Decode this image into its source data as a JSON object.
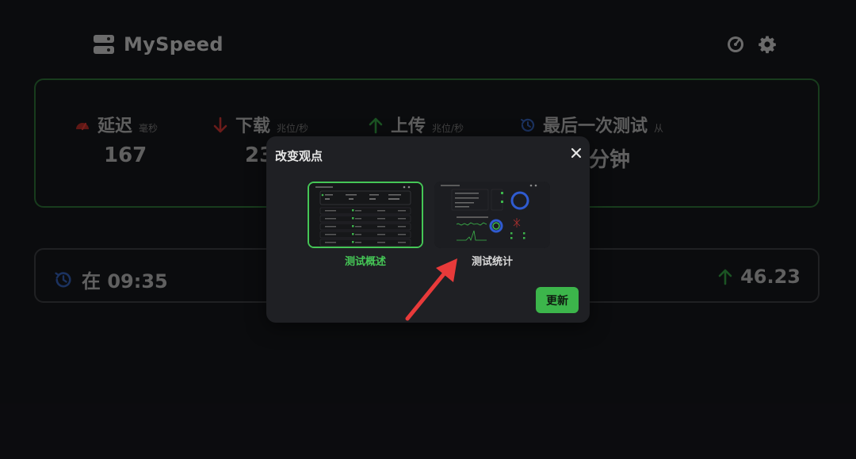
{
  "header": {
    "app_title": "MySpeed",
    "logo_icon": "server-icon",
    "right_icons": [
      "speedometer-icon",
      "gear-icon"
    ]
  },
  "stats": [
    {
      "icon": "ping-icon",
      "label": "延迟",
      "unit": "毫秒",
      "value": "167",
      "color": "#c8322c"
    },
    {
      "icon": "arrow-down-icon",
      "label": "下载",
      "unit": "兆位/秒",
      "value": "23",
      "color": "#b82e2a"
    },
    {
      "icon": "arrow-up-icon",
      "label": "上传",
      "unit": "兆位/秒",
      "value": "",
      "color": "#2e8a3a"
    },
    {
      "icon": "history-icon",
      "label": "最后一次测试",
      "unit": "从",
      "value": "分钟",
      "color": "#2a4d8f"
    }
  ],
  "latest": {
    "time_text": "在 09:35",
    "upload_value": "46.23"
  },
  "dialog": {
    "title": "改变观点",
    "options": [
      {
        "caption": "测试概述",
        "selected": true
      },
      {
        "caption": "测试统计",
        "selected": false
      }
    ],
    "update_label": "更新"
  },
  "colors": {
    "accent_green": "#45c656",
    "button_green": "#3cb54b",
    "annotation_red": "#e83a3a"
  }
}
